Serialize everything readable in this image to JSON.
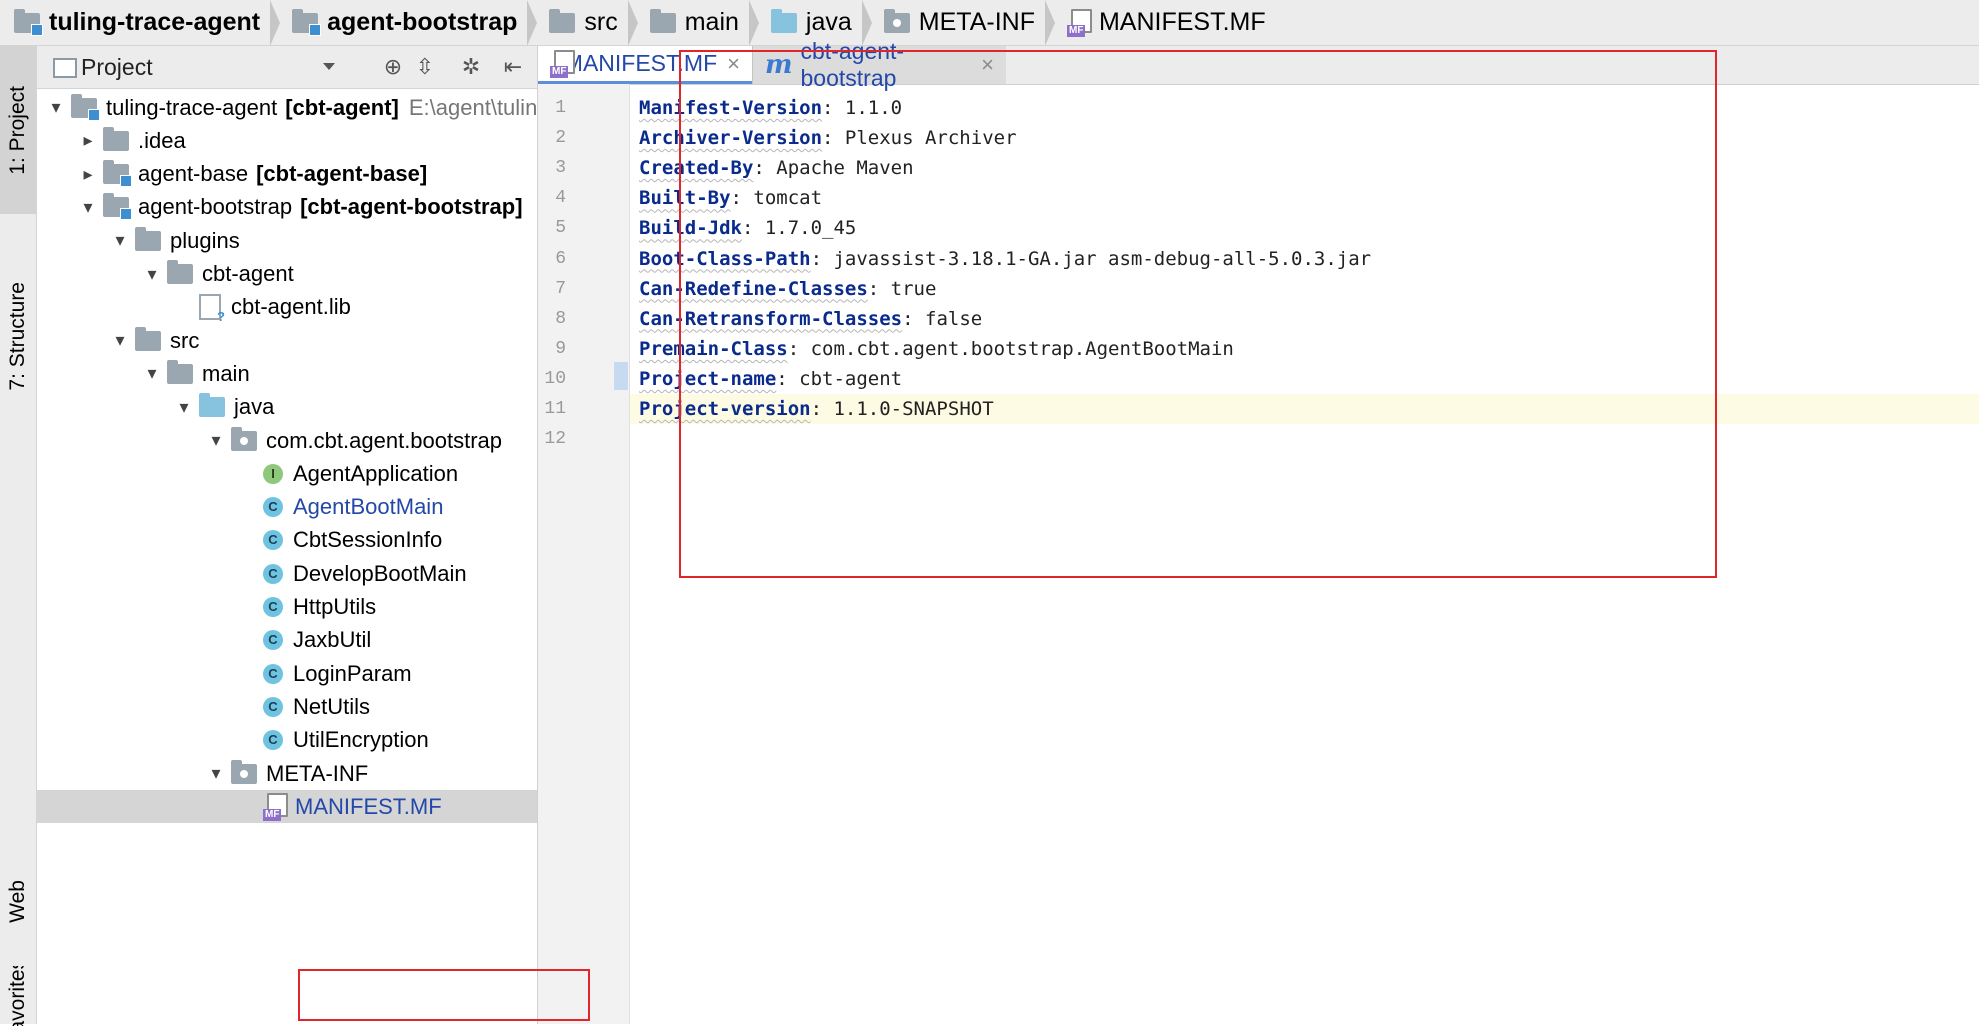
{
  "breadcrumbs": [
    {
      "label": "tuling-trace-agent",
      "icon": "module-folder-icon",
      "bold": true
    },
    {
      "label": "agent-bootstrap",
      "icon": "module-folder-icon",
      "bold": true
    },
    {
      "label": "src",
      "icon": "folder-icon",
      "bold": false
    },
    {
      "label": "main",
      "icon": "folder-icon",
      "bold": false
    },
    {
      "label": "java",
      "icon": "source-folder-icon",
      "bold": false
    },
    {
      "label": "META-INF",
      "icon": "package-folder-icon",
      "bold": false
    },
    {
      "label": "MANIFEST.MF",
      "icon": "manifest-file-icon",
      "bold": false
    }
  ],
  "tool_strip": {
    "project": "1: Project",
    "structure": "7: Structure",
    "web": "Web",
    "favorites": "avorites"
  },
  "project_panel": {
    "title": "Project",
    "mf_tag": "MF"
  },
  "tree": [
    {
      "indent": 0,
      "arrow": "▾",
      "icon": "module",
      "label": "tuling-trace-agent",
      "bold_suffix": "[cbt-agent]",
      "path": "E:\\agent\\tuling-t"
    },
    {
      "indent": 1,
      "arrow": "▸",
      "icon": "folder",
      "label": ".idea"
    },
    {
      "indent": 1,
      "arrow": "▸",
      "icon": "module",
      "label": "agent-base",
      "bold_suffix": "[cbt-agent-base]"
    },
    {
      "indent": 1,
      "arrow": "▾",
      "icon": "module",
      "label": "agent-bootstrap",
      "bold_suffix": "[cbt-agent-bootstrap]"
    },
    {
      "indent": 2,
      "arrow": "▾",
      "icon": "folder",
      "label": "plugins"
    },
    {
      "indent": 3,
      "arrow": "▾",
      "icon": "folder",
      "label": "cbt-agent"
    },
    {
      "indent": 4,
      "arrow": "",
      "icon": "lib",
      "label": "cbt-agent.lib"
    },
    {
      "indent": 2,
      "arrow": "▾",
      "icon": "folder",
      "label": "src"
    },
    {
      "indent": 3,
      "arrow": "▾",
      "icon": "folder",
      "label": "main"
    },
    {
      "indent": 4,
      "arrow": "▾",
      "icon": "source",
      "label": "java"
    },
    {
      "indent": 5,
      "arrow": "▾",
      "icon": "package",
      "label": "com.cbt.agent.bootstrap"
    },
    {
      "indent": 6,
      "arrow": "",
      "icon": "interface",
      "label": "AgentApplication",
      "icon_letter": "I"
    },
    {
      "indent": 6,
      "arrow": "",
      "icon": "class",
      "label": "AgentBootMain",
      "icon_letter": "C",
      "blue": true
    },
    {
      "indent": 6,
      "arrow": "",
      "icon": "class",
      "label": "CbtSessionInfo",
      "icon_letter": "C"
    },
    {
      "indent": 6,
      "arrow": "",
      "icon": "class",
      "label": "DevelopBootMain",
      "icon_letter": "C"
    },
    {
      "indent": 6,
      "arrow": "",
      "icon": "class",
      "label": "HttpUtils",
      "icon_letter": "C"
    },
    {
      "indent": 6,
      "arrow": "",
      "icon": "class",
      "label": "JaxbUtil",
      "icon_letter": "C"
    },
    {
      "indent": 6,
      "arrow": "",
      "icon": "class",
      "label": "LoginParam",
      "icon_letter": "C"
    },
    {
      "indent": 6,
      "arrow": "",
      "icon": "class",
      "label": "NetUtils",
      "icon_letter": "C"
    },
    {
      "indent": 6,
      "arrow": "",
      "icon": "class",
      "label": "UtilEncryption",
      "icon_letter": "C"
    },
    {
      "indent": 5,
      "arrow": "▾",
      "icon": "package",
      "label": "META-INF"
    },
    {
      "indent": 6,
      "arrow": "",
      "icon": "manifest",
      "label": "MANIFEST.MF",
      "blue": true,
      "selected": true
    }
  ],
  "editor": {
    "tabs": [
      {
        "label": "MANIFEST.MF",
        "close": "×",
        "active": true
      },
      {
        "label": "cbt-agent-bootstrap",
        "close": "×",
        "active": false
      }
    ],
    "maven_icon_glyph": "m",
    "lines": [
      {
        "n": "1",
        "key": "Manifest-Version",
        "value": "1.1.0"
      },
      {
        "n": "2",
        "key": "Archiver-Version",
        "value": "Plexus Archiver"
      },
      {
        "n": "3",
        "key": "Created-By",
        "value": "Apache Maven"
      },
      {
        "n": "4",
        "key": "Built-By",
        "value": "tomcat"
      },
      {
        "n": "5",
        "key": "Build-Jdk",
        "value": "1.7.0_45"
      },
      {
        "n": "6",
        "key": "Boot-Class-Path",
        "value": "javassist-3.18.1-GA.jar asm-debug-all-5.0.3.jar"
      },
      {
        "n": "7",
        "key": "Can-Redefine-Classes",
        "value": "true"
      },
      {
        "n": "8",
        "key": "Can-Retransform-Classes",
        "value": "false"
      },
      {
        "n": "9",
        "key": "Premain-Class",
        "value": "com.cbt.agent.bootstrap.AgentBootMain"
      },
      {
        "n": "10",
        "key": "Project-name",
        "value": "cbt-agent"
      },
      {
        "n": "11",
        "key": "Project-version",
        "value": "1.1.0-SNAPSHOT",
        "current": true
      },
      {
        "n": "12",
        "key": "",
        "value": ""
      }
    ]
  },
  "colors": {
    "annotation_red": "#e0262b",
    "key_blue": "#0a2b8c",
    "link_blue": "#2448a8",
    "class_icon": "#6ec4e0",
    "interface_icon": "#8fc87a"
  }
}
